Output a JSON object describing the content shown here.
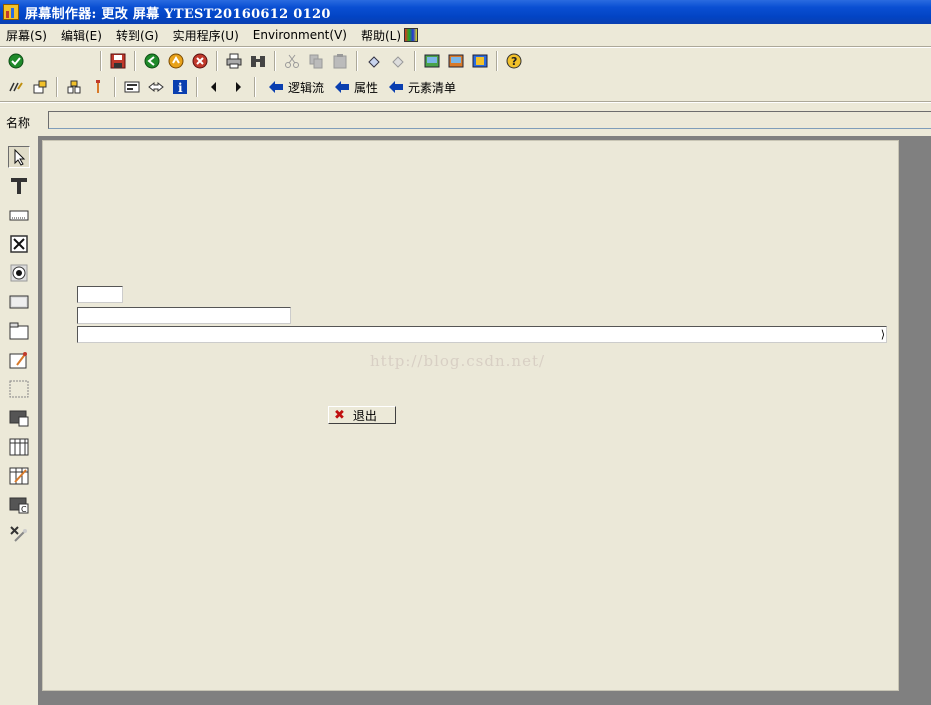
{
  "window": {
    "title": "屏幕制作器:  更改 屏幕 YTEST20160612 0120"
  },
  "menubar": {
    "items": [
      {
        "label": "屏幕(S)"
      },
      {
        "label": "编辑(E)"
      },
      {
        "label": "转到(G)"
      },
      {
        "label": "实用程序(U)"
      },
      {
        "label": "Environment(V)"
      },
      {
        "label": "帮助(L)"
      }
    ]
  },
  "toolbar2": {
    "links": [
      {
        "label": "逻辑流"
      },
      {
        "label": "属性"
      },
      {
        "label": "元素清单"
      }
    ]
  },
  "name_row": {
    "label": "名称",
    "value": ""
  },
  "palette": {
    "tools": [
      {
        "name": "pointer-tool-icon"
      },
      {
        "name": "text-field-tool-icon"
      },
      {
        "name": "input-field-tool-icon"
      },
      {
        "name": "checkbox-tool-icon"
      },
      {
        "name": "radio-button-tool-icon"
      },
      {
        "name": "pushbutton-tool-icon"
      },
      {
        "name": "tabstrip-tool-icon"
      },
      {
        "name": "tabstrip-wizard-tool-icon"
      },
      {
        "name": "box-tool-icon"
      },
      {
        "name": "subscreen-tool-icon"
      },
      {
        "name": "table-control-tool-icon"
      },
      {
        "name": "table-wizard-tool-icon"
      },
      {
        "name": "custom-control-tool-icon"
      },
      {
        "name": "status-icon-tool-icon"
      }
    ]
  },
  "canvas": {
    "watermark": "http://blog.csdn.net/",
    "exit_button": {
      "label": "退出",
      "icon": "cancel-x-icon"
    },
    "long_field_end": "⟩"
  }
}
